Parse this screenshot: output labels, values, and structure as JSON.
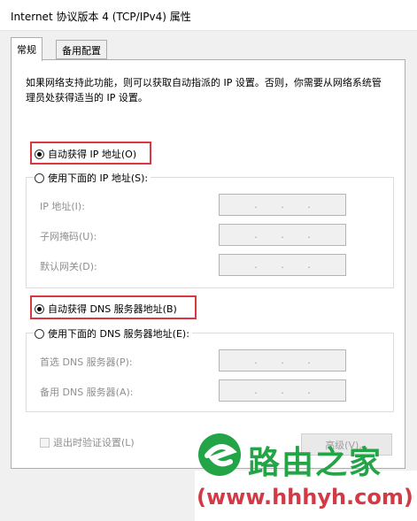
{
  "window": {
    "title": "Internet 协议版本 4 (TCP/IPv4) 属性"
  },
  "tabs": [
    {
      "label": "常规",
      "active": true
    },
    {
      "label": "备用配置",
      "active": false
    }
  ],
  "description": "如果网络支持此功能，则可以获取自动指派的 IP 设置。否则，你需要从网络系统管理员处获得适当的 IP 设置。",
  "ip_section": {
    "auto_label": "自动获得 IP 地址(O)",
    "auto_checked": true,
    "manual_label": "使用下面的 IP 地址(S):",
    "manual_checked": false,
    "fields": [
      {
        "label": "IP 地址(I):"
      },
      {
        "label": "子网掩码(U):"
      },
      {
        "label": "默认网关(D):"
      }
    ]
  },
  "dns_section": {
    "auto_label": "自动获得 DNS 服务器地址(B)",
    "auto_checked": true,
    "manual_label": "使用下面的 DNS 服务器地址(E):",
    "manual_checked": false,
    "fields": [
      {
        "label": "首选 DNS 服务器(P):"
      },
      {
        "label": "备用 DNS 服务器(A):"
      }
    ]
  },
  "validate_label": "退出时验证设置(L)",
  "advanced_label": "高级(V)...",
  "ip_dot": ".",
  "watermark": {
    "brand": "路由之家",
    "url": "(www.hhhyh.com)",
    "brand_color": "#22a447",
    "url_color": "#d33a46"
  },
  "colors": {
    "highlight": "#d9383f"
  }
}
